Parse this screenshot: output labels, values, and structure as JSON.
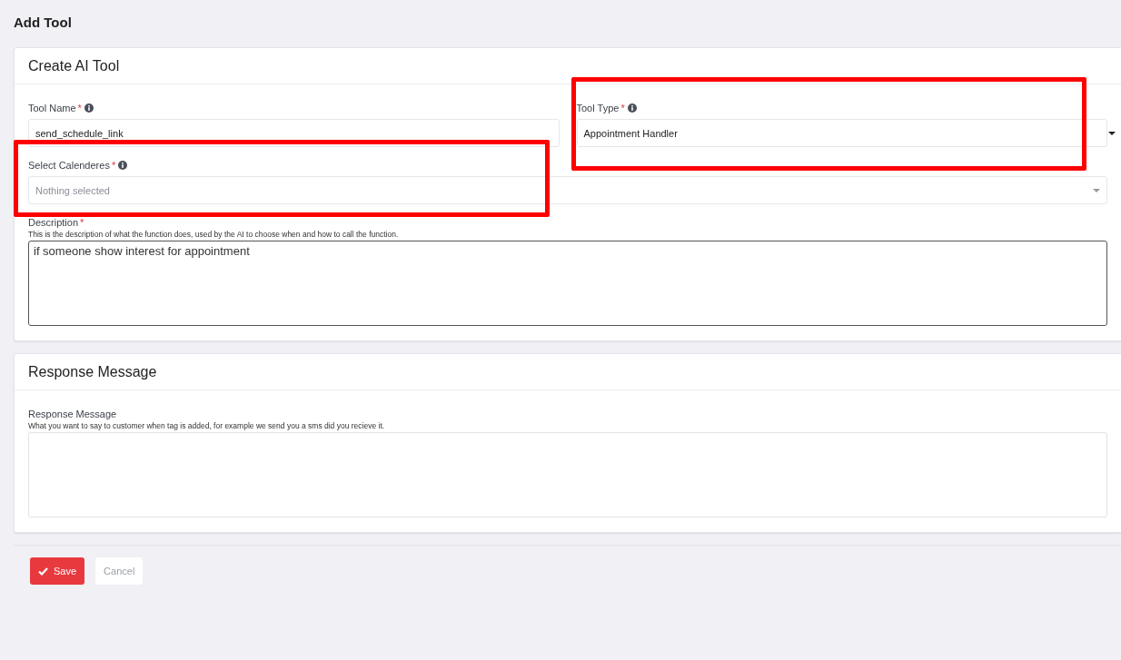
{
  "page_title": "Add Tool",
  "cards": [
    {
      "title": "Create AI Tool",
      "fields": [
        {
          "kind": "text",
          "label": "Tool Name",
          "required_mark": "*",
          "info": true,
          "value": "send_schedule_link",
          "highlighted": false,
          "half": true
        },
        {
          "kind": "select",
          "label": "Tool Type",
          "required_mark": "*",
          "info": true,
          "value": "Appointment Handler",
          "highlighted": true,
          "half": true
        },
        {
          "kind": "multiselect",
          "label": "Select Calenderes",
          "required_mark": "*",
          "info": true,
          "placeholder": "Nothing selected",
          "highlighted": true,
          "half": false
        },
        {
          "kind": "textarea",
          "label": "Description",
          "required_mark": "*",
          "info": false,
          "help": "This is the description of what the function does, used by the AI to choose when and how to call the function.",
          "value": "if someone show interest for appointment",
          "highlighted": false,
          "half": false
        }
      ]
    },
    {
      "title": "Response Message",
      "fields": [
        {
          "kind": "textarea",
          "label": "Response Message",
          "info": false,
          "help": "What you want to say to customer when tag is added, for example we send you a sms did you recieve it.",
          "highlighted": false,
          "half": false
        }
      ]
    }
  ],
  "buttons": [
    {
      "kind": "primary",
      "label": "Save"
    },
    {
      "kind": "secondary",
      "label": "Cancel"
    }
  ]
}
